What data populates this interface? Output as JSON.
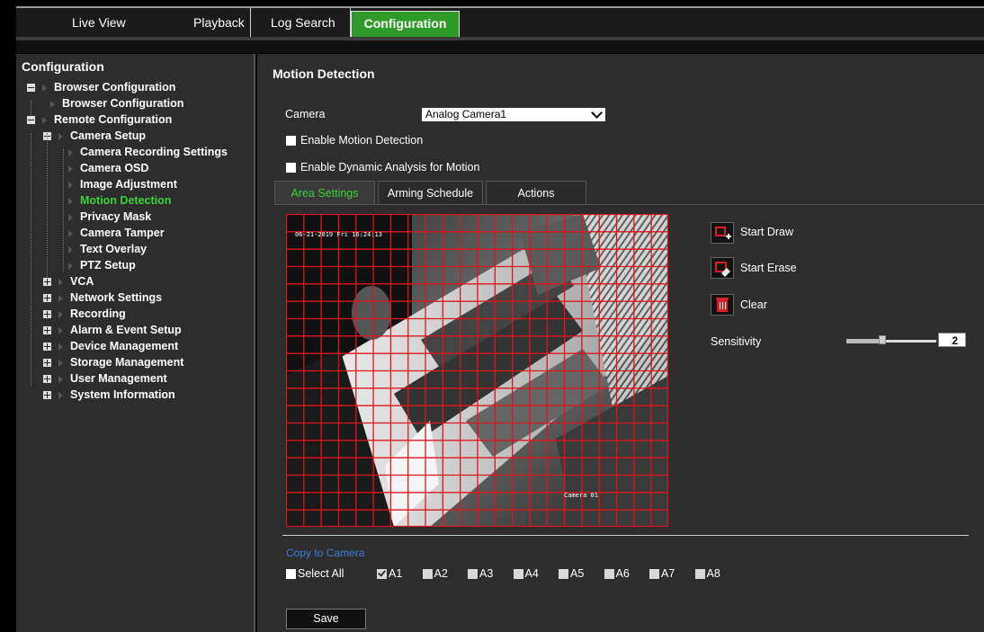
{
  "nav": {
    "tabs": [
      {
        "label": "Live View"
      },
      {
        "label": "Playback"
      },
      {
        "label": "Log Search"
      },
      {
        "label": "Configuration",
        "active": true
      }
    ]
  },
  "sidebar": {
    "title": "Configuration",
    "tree": [
      {
        "label": "Browser Configuration",
        "level": 0,
        "expander": "minus"
      },
      {
        "label": "Browser Configuration",
        "level": 1
      },
      {
        "label": "Remote Configuration",
        "level": 0,
        "expander": "minus"
      },
      {
        "label": "Camera Setup",
        "level": 1,
        "expander": "minus"
      },
      {
        "label": "Camera Recording Settings",
        "level": 2
      },
      {
        "label": "Camera OSD",
        "level": 2
      },
      {
        "label": "Image Adjustment",
        "level": 2
      },
      {
        "label": "Motion Detection",
        "level": 2,
        "active": true
      },
      {
        "label": "Privacy Mask",
        "level": 2
      },
      {
        "label": "Camera Tamper",
        "level": 2
      },
      {
        "label": "Text Overlay",
        "level": 2
      },
      {
        "label": "PTZ Setup",
        "level": 2
      },
      {
        "label": "VCA",
        "level": 1,
        "expander": "plus"
      },
      {
        "label": "Network Settings",
        "level": 1,
        "expander": "plus"
      },
      {
        "label": "Recording",
        "level": 1,
        "expander": "plus"
      },
      {
        "label": "Alarm & Event Setup",
        "level": 1,
        "expander": "plus"
      },
      {
        "label": "Device Management",
        "level": 1,
        "expander": "plus"
      },
      {
        "label": "Storage Management",
        "level": 1,
        "expander": "plus"
      },
      {
        "label": "User Management",
        "level": 1,
        "expander": "plus"
      },
      {
        "label": "System Information",
        "level": 1,
        "expander": "plus"
      }
    ]
  },
  "main": {
    "title": "Motion Detection",
    "camera_label": "Camera",
    "camera_value": "Analog Camera1",
    "enable_motion": {
      "label": "Enable Motion Detection",
      "checked": false
    },
    "enable_dynamic": {
      "label": "Enable Dynamic Analysis for Motion",
      "checked": false
    },
    "tabs": [
      {
        "label": "Area Settings",
        "active": true
      },
      {
        "label": "Arming Schedule"
      },
      {
        "label": "Actions"
      }
    ],
    "video": {
      "osd_time": "06-21-2019 Fri 16:24:13",
      "osd_camera": "Camera 01",
      "grid_color": "#e0141e"
    },
    "tools": {
      "start_draw": "Start Draw",
      "start_erase": "Start Erase",
      "clear": "Clear"
    },
    "sensitivity": {
      "label": "Sensitivity",
      "value": "2",
      "level_fraction": 0.4
    },
    "copy": {
      "title": "Copy to Camera",
      "select_all": "Select All",
      "cameras": [
        {
          "label": "A1",
          "checked": true
        },
        {
          "label": "A2"
        },
        {
          "label": "A3"
        },
        {
          "label": "A4"
        },
        {
          "label": "A5"
        },
        {
          "label": "A6"
        },
        {
          "label": "A7"
        },
        {
          "label": "A8"
        }
      ]
    },
    "save_label": "Save"
  },
  "colors": {
    "accent_green": "#3ad23a",
    "tab_green": "#2e9a2a",
    "link_blue": "#3b7fd6",
    "icon_red": "#d81f26"
  }
}
